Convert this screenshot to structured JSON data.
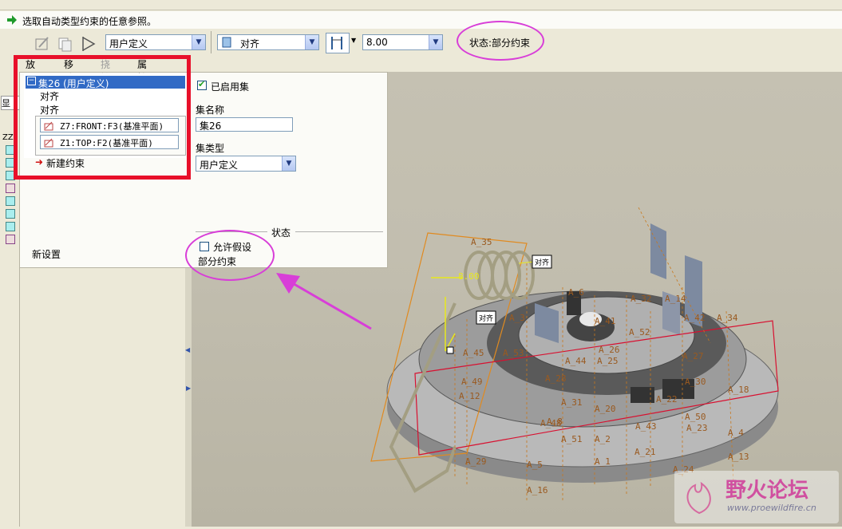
{
  "prompt": {
    "text": "选取自动类型约束的任意参照。"
  },
  "dashboard": {
    "constraint_type": "用户定义",
    "align_type": "对齐",
    "offset_value": "8.00",
    "status": "状态:部分约束"
  },
  "tabs": [
    "放置",
    "移动",
    "挠性",
    "属性"
  ],
  "placement": {
    "set_header": "集26 (用户定义)",
    "constraints": [
      "对齐",
      "对齐"
    ],
    "references": [
      "Z7:FRONT:F3(基准平面)",
      "Z1:TOP:F2(基准平面)"
    ],
    "new_constraint": "新建约束",
    "new_set": "新设置"
  },
  "right_panel": {
    "enabled_checkbox": "已启用集",
    "enabled": true,
    "set_name_label": "集名称",
    "set_name_value": "集26",
    "set_type_label": "集类型",
    "set_type_value": "用户定义",
    "status_group": "状态",
    "allow_assumptions": "允许假设",
    "allow_assumptions_checked": false,
    "status_value": "部分约束"
  },
  "viewport": {
    "datum_labels": [
      "A_35",
      "A_6",
      "A_32",
      "A_14",
      "A_3",
      "A_41",
      "A_42",
      "A_34",
      "A_52",
      "A_26",
      "A_53",
      "A_25",
      "A_27",
      "A_28",
      "A_45",
      "A_44",
      "A_49",
      "A_12",
      "A_31",
      "A_20",
      "A_22",
      "A_30",
      "A_18",
      "A_50",
      "A_23",
      "A_43",
      "A_48",
      "A_51",
      "A_2",
      "A_4",
      "A_29",
      "A_5",
      "A_16",
      "A_21",
      "A_24",
      "A_1",
      "A_13",
      "A_8"
    ],
    "offset_label": "8.00",
    "tag_labels": [
      "对齐",
      "对齐"
    ]
  },
  "watermark": {
    "title": "野火论坛",
    "url": "www.proewildfire.cn"
  },
  "colors": {
    "highlight": "#e8102a",
    "annotation": "#d83ed8",
    "selection": "#316ac5"
  }
}
